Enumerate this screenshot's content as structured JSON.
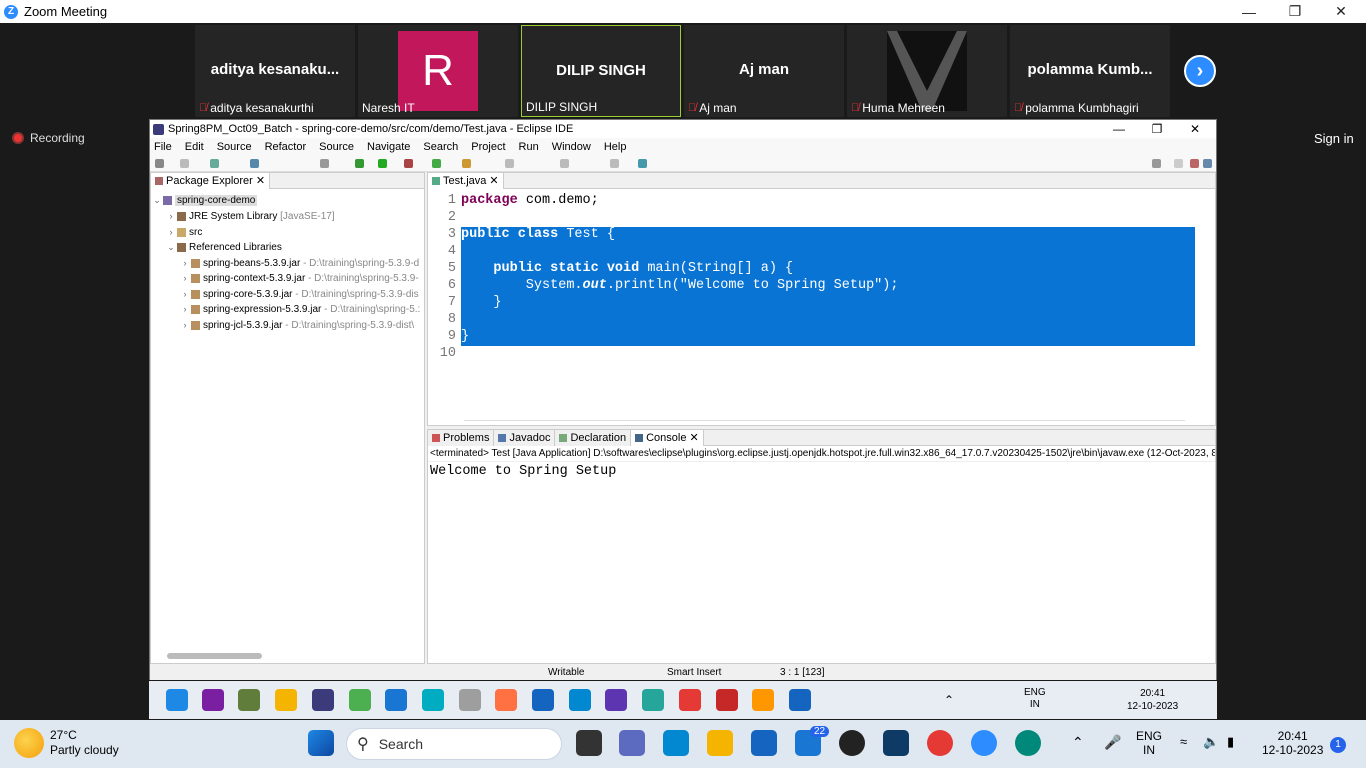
{
  "zoom": {
    "title": "Zoom Meeting",
    "participants": [
      {
        "big": "aditya  kesanaku...",
        "name": "aditya kesanakurthi",
        "muted": true
      },
      {
        "big": "R",
        "name": "Naresh IT",
        "muted": false
      },
      {
        "big": "DILIP SINGH",
        "name": "DILIP SINGH",
        "muted": false
      },
      {
        "big": "Aj man",
        "name": "Aj man",
        "muted": true
      },
      {
        "big": "",
        "name": "Huma Mehreen",
        "muted": true
      },
      {
        "big": "polamma  Kumb...",
        "name": "polamma Kumbhagiri",
        "muted": true
      }
    ],
    "recording": "Recording",
    "sign_in": "Sign in"
  },
  "eclipse": {
    "title": "Spring8PM_Oct09_Batch - spring-core-demo/src/com/demo/Test.java - Eclipse IDE",
    "menu": [
      "File",
      "Edit",
      "Source",
      "Refactor",
      "Source",
      "Navigate",
      "Search",
      "Project",
      "Run",
      "Window",
      "Help"
    ],
    "package_explorer": {
      "tab": "Package Explorer",
      "project": "spring-core-demo",
      "jre": "JRE System Library",
      "jre_version": "[JavaSE-17]",
      "src": "src",
      "ref_libs": "Referenced Libraries",
      "jars": [
        {
          "name": "spring-beans-5.3.9.jar",
          "path": "- D:\\training\\spring-5.3.9-d"
        },
        {
          "name": "spring-context-5.3.9.jar",
          "path": "- D:\\training\\spring-5.3.9-"
        },
        {
          "name": "spring-core-5.3.9.jar",
          "path": "- D:\\training\\spring-5.3.9-dis"
        },
        {
          "name": "spring-expression-5.3.9.jar",
          "path": "- D:\\training\\spring-5.:"
        },
        {
          "name": "spring-jcl-5.3.9.jar",
          "path": "- D:\\training\\spring-5.3.9-dist\\"
        }
      ]
    },
    "editor": {
      "tab": "Test.java",
      "lines": [
        "1",
        "2",
        "3",
        "4",
        "5",
        "6",
        "7",
        "8",
        "9",
        "10"
      ],
      "code": {
        "l1_kw": "package",
        "l1_rest": " com.demo;",
        "l3_kw": "public class",
        "l3_rest": " Test {",
        "l5_kw": "    public static void",
        "l5_rest": " main(String[] a) {",
        "l6_a": "        System.",
        "l6_b": "out",
        "l6_c": ".println(\"Welcome to Spring Setup\");",
        "l7": "    }",
        "l9": "}"
      }
    },
    "bottom_tabs": [
      "Problems",
      "Javadoc",
      "Declaration",
      "Console"
    ],
    "console_header": "<terminated> Test [Java Application] D:\\softwares\\eclipse\\plugins\\org.eclipse.justj.openjdk.hotspot.jre.full.win32.x86_64_17.0.7.v20230425-1502\\jre\\bin\\javaw.exe  (12-Oct-2023, 8",
    "console_output": "Welcome to Spring Setup",
    "status": {
      "writable": "Writable",
      "insert": "Smart Insert",
      "pos": "3 : 1 [123]"
    }
  },
  "inner_taskbar": {
    "lang1": "ENG",
    "lang2": "IN",
    "time": "20:41",
    "date": "12-10-2023"
  },
  "taskbar": {
    "temp": "27°C",
    "weather": "Partly cloudy",
    "search": "Search",
    "mail_badge": "22",
    "lang1": "ENG",
    "lang2": "IN",
    "time": "20:41",
    "date": "12-10-2023",
    "notif": "1"
  }
}
